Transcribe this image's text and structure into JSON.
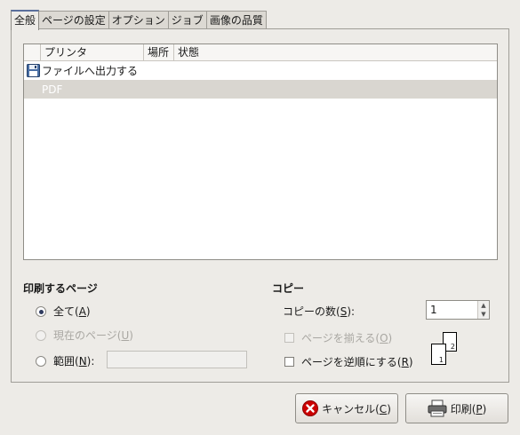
{
  "tabs": [
    {
      "label": "全般",
      "active": true
    },
    {
      "label": "ページの設定",
      "active": false
    },
    {
      "label": "オプション",
      "active": false
    },
    {
      "label": "ジョブ",
      "active": false
    },
    {
      "label": "画像の品質",
      "active": false
    }
  ],
  "printer_list": {
    "columns": [
      "プリンタ",
      "場所",
      "状態"
    ],
    "rows": [
      {
        "name": "ファイルへ出力する",
        "icon": "floppy-disk-icon",
        "selected": false
      },
      {
        "name": "PDF",
        "icon": "",
        "selected": true
      }
    ]
  },
  "print_pages": {
    "title": "印刷するページ",
    "all_label": "全て(A)",
    "all_main": "全て(",
    "all_key": "A",
    "all_tail": ")",
    "current_main": "現在のページ(",
    "current_key": "U",
    "current_tail": ")",
    "range_main": "範囲(",
    "range_key": "N",
    "range_tail": "):",
    "range_value": "",
    "selected": "all"
  },
  "copies": {
    "title": "コピー",
    "count_main": "コピーの数(",
    "count_key": "S",
    "count_tail": "):",
    "count_value": "1",
    "collate_main": "ページを揃える(",
    "collate_key": "O",
    "collate_tail": ")",
    "reverse_main": "ページを逆順にする(",
    "reverse_key": "R",
    "reverse_tail": ")",
    "collate_checked": false,
    "reverse_checked": false,
    "preview_pages": [
      "1",
      "2"
    ]
  },
  "buttons": {
    "cancel_main": "キャンセル(",
    "cancel_key": "C",
    "cancel_tail": ")",
    "print_main": "印刷(",
    "print_key": "P",
    "print_tail": ")"
  },
  "colors": {
    "tab_accent": "#5a6f9c",
    "selection": "#d9d6d0",
    "cancel_icon": "#cc0000"
  }
}
